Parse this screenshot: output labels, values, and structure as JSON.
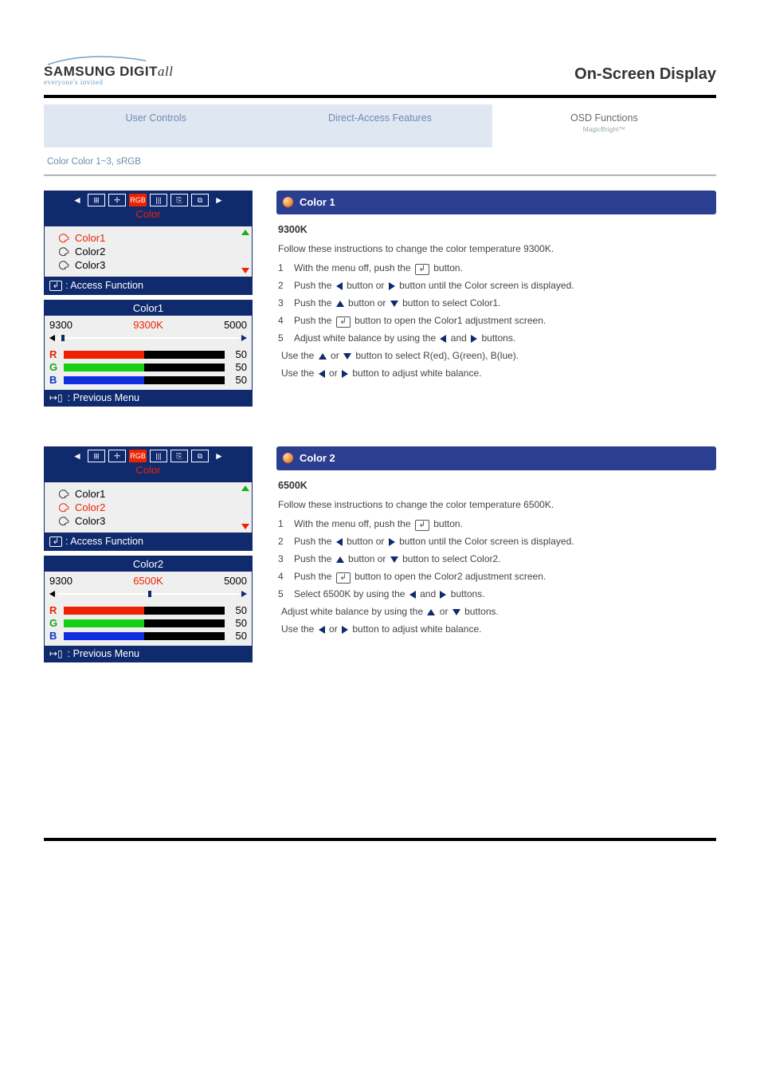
{
  "logo": {
    "brand_main": "SAMSUNG",
    "brand_sub1": "DIGIT",
    "brand_sub2": "all",
    "tagline": "everyone's invited"
  },
  "page_title": "On-Screen Display",
  "nav": {
    "items": [
      {
        "label": "User Controls"
      },
      {
        "label": "Direct-Access Features"
      },
      {
        "label": "OSD Functions"
      }
    ],
    "footnote": "MagicBright™"
  },
  "breadcrumbs": "Color  Color 1~3, sRGB",
  "osd_top": {
    "tabs_label": "Color",
    "icons": [
      "◄",
      "⊞",
      "⊕",
      "RGB",
      "|||",
      "⎘",
      "⧉",
      "►"
    ]
  },
  "color1": {
    "list": [
      "Color1",
      "Color2",
      "Color3"
    ],
    "list_footer": ": Access Function",
    "panel_title": "Color1",
    "range_left": "9300",
    "range_center": "9300K",
    "range_right": "5000",
    "tick_pct": 2,
    "rgb": [
      {
        "lab": "R",
        "val": "50",
        "pct": 50
      },
      {
        "lab": "G",
        "val": "50",
        "pct": 50
      },
      {
        "lab": "B",
        "val": "50",
        "pct": 50
      }
    ],
    "panel_footer": ": Previous Menu",
    "right": {
      "title": "Color 1",
      "subtitle": "9300K",
      "intro": "Follow these instructions to change the color temperature 9300K.",
      "steps": [
        {
          "num": "1",
          "text_a": "With the menu off, push the",
          "text_b": "button."
        },
        {
          "num": "2",
          "text_a": "Push the",
          "text_b": "button or",
          "text_c": "button until the Color screen is displayed."
        },
        {
          "num": "3",
          "text_a": "Push the ",
          "text_b": "button or ",
          "text_c": "button to select Color1."
        },
        {
          "num": "4",
          "text_a": "Push the",
          "text_b": "button to open the Color1 adjustment screen."
        },
        {
          "num": "5",
          "text_a": "Adjust white balance by using the ",
          "text_b": " and ",
          "text_c": " buttons."
        },
        {
          "note_a": "Use the ",
          "note_b": " or ",
          "note_c": " button to select R(ed), G(reen), B(lue)."
        },
        {
          "note_a": "Use the ",
          "note_b": " or ",
          "note_c": " button to adjust white balance."
        }
      ]
    }
  },
  "color2": {
    "list": [
      "Color1",
      "Color2",
      "Color3"
    ],
    "list_footer": ": Access Function",
    "panel_title": "Color2",
    "range_left": "9300",
    "range_center": "6500K",
    "range_right": "5000",
    "tick_pct": 50,
    "rgb": [
      {
        "lab": "R",
        "val": "50",
        "pct": 50
      },
      {
        "lab": "G",
        "val": "50",
        "pct": 50
      },
      {
        "lab": "B",
        "val": "50",
        "pct": 50
      }
    ],
    "panel_footer": ": Previous Menu",
    "right": {
      "title": "Color 2",
      "subtitle": "6500K",
      "intro": "Follow these instructions to change the color temperature 6500K.",
      "steps": [
        {
          "num": "1",
          "text_a": "With the menu off, push the",
          "text_b": "button."
        },
        {
          "num": "2",
          "text_a": "Push the",
          "text_b": "button or",
          "text_c": "button until the Color screen is displayed."
        },
        {
          "num": "3",
          "text_a": "Push the ",
          "text_b": "button or ",
          "text_c": "button to select Color2."
        },
        {
          "num": "4",
          "text_a": "Push the",
          "text_b": "button to open the Color2 adjustment screen."
        },
        {
          "num": "5",
          "text_a": "Select 6500K by using the ",
          "text_b": " and ",
          "text_c": " buttons."
        },
        {
          "note_a": "Adjust white balance by using the ",
          "note_b": " or ",
          "note_c": " buttons."
        },
        {
          "note_a": "Use the ",
          "note_b": " or ",
          "note_c": " button to adjust white balance."
        }
      ]
    }
  }
}
